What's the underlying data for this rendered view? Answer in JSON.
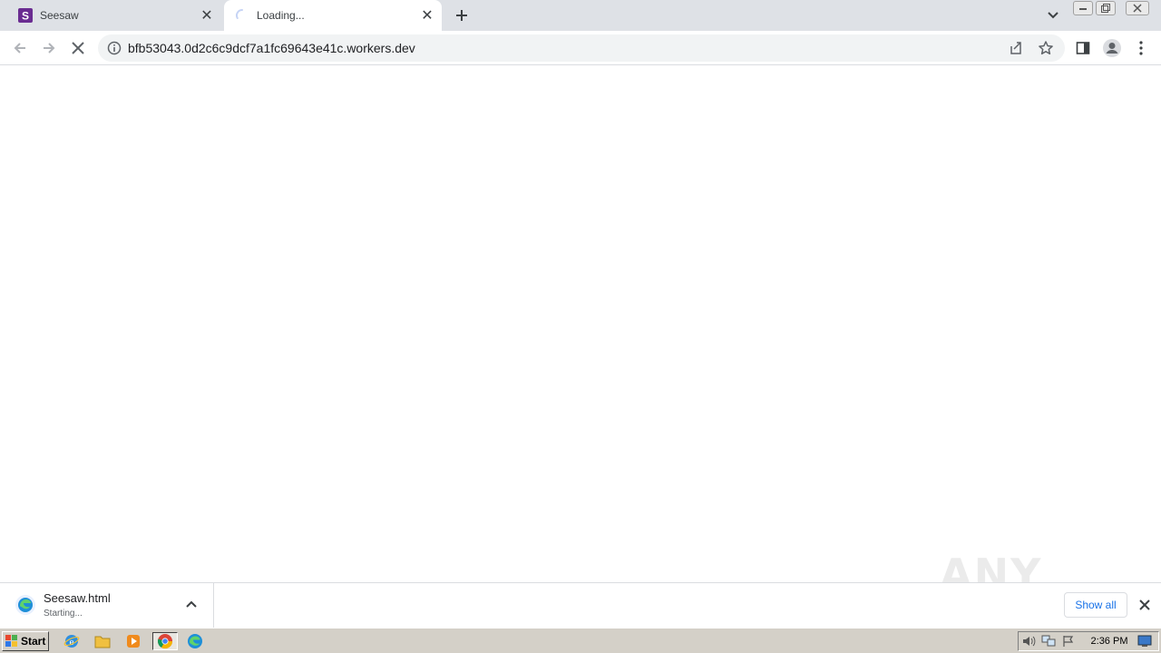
{
  "browser": {
    "tabs": [
      {
        "title": "Seesaw",
        "favicon": "seesaw-icon",
        "active": false
      },
      {
        "title": "Loading...",
        "favicon": "loading-spinner-icon",
        "active": true
      }
    ],
    "address": "bfb53043.0d2c6c9dcf7a1fc69643e41c.workers.dev"
  },
  "download_bar": {
    "filename": "Seesaw.html",
    "status": "Starting...",
    "show_all_label": "Show all"
  },
  "watermark": "ANY RUN",
  "taskbar": {
    "start_label": "Start",
    "clock": "2:36 PM"
  },
  "colors": {
    "tabstrip": "#dee1e6",
    "seesaw_brand": "#6a2c91",
    "link_blue": "#1a73e8",
    "taskbar": "#d4d0c8"
  }
}
